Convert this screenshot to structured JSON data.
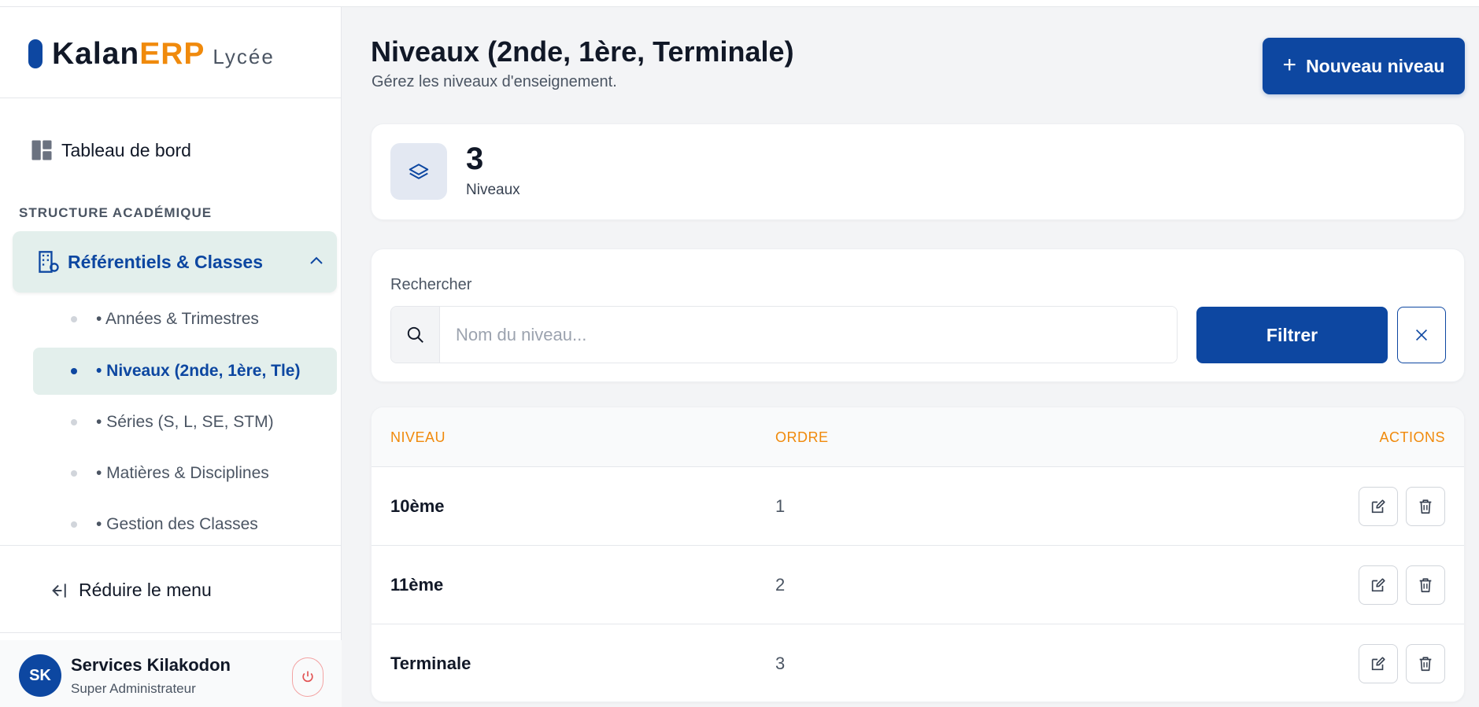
{
  "brand": {
    "name_part1": "Kalan",
    "name_part2": "ERP",
    "suffix": "Lycée",
    "color": "#0d47a1",
    "accent": "#f08a0c"
  },
  "sidebar": {
    "dashboard_label": "Tableau de bord",
    "dashboard_icon": "dashboard-icon",
    "section_title": "STRUCTURE ACADÉMIQUE",
    "group": {
      "label": "Référentiels & Classes",
      "icon": "building-icon",
      "expanded": true
    },
    "items": [
      {
        "label": "• Années & Trimestres",
        "active": false
      },
      {
        "label": "• Niveaux (2nde, 1ère, Tle)",
        "active": true
      },
      {
        "label": "• Séries (S, L, SE, STM)",
        "active": false
      },
      {
        "label": "• Matières & Disciplines",
        "active": false
      },
      {
        "label": "• Gestion des Classes",
        "active": false
      }
    ],
    "collapse_label": "Réduire le menu"
  },
  "user": {
    "initials": "SK",
    "name": "Services Kilakodon",
    "role": "Super Administrateur"
  },
  "header": {
    "title": "Niveaux (2nde, 1ère, Terminale)",
    "subtitle": "Gérez les niveaux d'enseignement.",
    "new_button": "Nouveau niveau",
    "new_button_icon": "plus-icon"
  },
  "stat": {
    "value": "3",
    "label": "Niveaux",
    "icon": "layers-icon"
  },
  "filter": {
    "label": "Rechercher",
    "placeholder": "Nom du niveau...",
    "value": "",
    "filter_button": "Filtrer",
    "clear_icon": "close-icon"
  },
  "table": {
    "columns": [
      "NIVEAU",
      "ORDRE",
      "ACTIONS"
    ],
    "rows": [
      {
        "niveau": "10ème",
        "ordre": "1"
      },
      {
        "niveau": "11ème",
        "ordre": "2"
      },
      {
        "niveau": "Terminale",
        "ordre": "3"
      }
    ]
  }
}
